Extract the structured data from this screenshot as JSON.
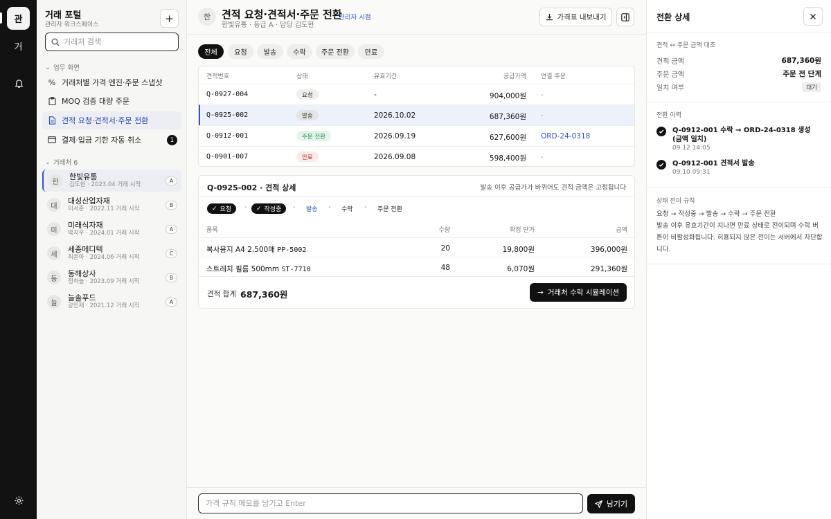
{
  "rail": {
    "active_label": "관",
    "second_label": "거"
  },
  "sidebar": {
    "title": "거래 포털",
    "subtitle": "관리자 워크스페이스",
    "search_placeholder": "거래처 검색",
    "section_screens": "업무 화면",
    "nav": [
      {
        "label": "거래처별 가격 엔진·주문 스냅샷",
        "icon": "percent-icon"
      },
      {
        "label": "MOQ 검증 대량 주문",
        "icon": "clipboard-icon"
      },
      {
        "label": "견적 요청·견적서·주문 전환",
        "icon": "document-icon",
        "active": true
      },
      {
        "label": "결제·입금 기한 자동 취소",
        "icon": "card-icon",
        "badge": "1"
      }
    ],
    "section_clients": "거래처 6",
    "clients": [
      {
        "initial": "한",
        "name": "한빛유통",
        "meta": "김도현 · 2023.04 거래 시작",
        "grade": "A",
        "active": true
      },
      {
        "initial": "대",
        "name": "대성산업자재",
        "meta": "이서준 · 2022.11 거래 시작",
        "grade": "B"
      },
      {
        "initial": "미",
        "name": "미래식자재",
        "meta": "박지우 · 2024.01 거래 시작",
        "grade": "A"
      },
      {
        "initial": "세",
        "name": "세종메디텍",
        "meta": "최윤아 · 2024.06 거래 시작",
        "grade": "C"
      },
      {
        "initial": "동",
        "name": "동해상사",
        "meta": "정하늘 · 2023.09 거래 시작",
        "grade": "B"
      },
      {
        "initial": "늘",
        "name": "늘솔푸드",
        "meta": "강민재 · 2021.12 거래 시작",
        "grade": "A"
      }
    ]
  },
  "header": {
    "avatar": "한",
    "title": "견적 요청·견적서·주문 전환",
    "subtitle": "한빛유통 · 등급 A · 담당 김도현",
    "view_link": "관리자 시점",
    "export_label": "가격표 내보내기"
  },
  "filters": [
    "전체",
    "요청",
    "발송",
    "수락",
    "주문 전환",
    "만료"
  ],
  "quotes": {
    "columns": [
      "견적번호",
      "상태",
      "유효기간",
      "공급가액",
      "연결 주문"
    ],
    "rows": [
      {
        "id": "Q-0927-004",
        "status": "요청",
        "status_kind": "request",
        "valid": "-",
        "amount": "904,000원",
        "order": "-"
      },
      {
        "id": "Q-0925-002",
        "status": "발송",
        "status_kind": "sent",
        "valid": "2026.10.02",
        "amount": "687,360원",
        "order": "-",
        "selected": true
      },
      {
        "id": "Q-0912-001",
        "status": "주문 전환",
        "status_kind": "converted",
        "valid": "2026.09.19",
        "amount": "627,600원",
        "order": "ORD-24-0318"
      },
      {
        "id": "Q-0901-007",
        "status": "만료",
        "status_kind": "expired",
        "valid": "2026.09.08",
        "amount": "598,400원",
        "order": "-"
      }
    ]
  },
  "detail": {
    "title": "Q-0925-002 · 견적 상세",
    "note": "발송 이후 공급가가 바뀌어도 견적 금액은 고정됩니다",
    "steps": [
      {
        "label": "요청",
        "state": "done"
      },
      {
        "label": "작성중",
        "state": "done"
      },
      {
        "label": "발송",
        "state": "current"
      },
      {
        "label": "수락",
        "state": "todo"
      },
      {
        "label": "주문 전환",
        "state": "todo"
      }
    ],
    "columns": [
      "품목",
      "수량",
      "확정 단가",
      "금액"
    ],
    "items": [
      {
        "name": "복사용지 A4 2,500매",
        "code": "PP-5002",
        "qty": "20",
        "price": "19,800원",
        "amount": "396,000원"
      },
      {
        "name": "스트레치 필름 500mm",
        "code": "ST-7710",
        "qty": "48",
        "price": "6,070원",
        "amount": "291,360원"
      }
    ],
    "total_label": "견적 합계",
    "total_value": "687,360원",
    "sim_label": "거래처 수락 시뮬레이션"
  },
  "footer": {
    "memo_placeholder": "가격 규칙 메모를 남기고 Enter",
    "send_label": "남기기"
  },
  "panel": {
    "title": "전환 상세",
    "compare_title": "견적 ↔ 주문 금액 대조",
    "compare": [
      {
        "key": "견적 금액",
        "value": "687,360원"
      },
      {
        "key": "주문 금액",
        "value": "주문 전 단계"
      },
      {
        "key": "일치 여부",
        "value": "대기",
        "tag": true
      }
    ],
    "history_title": "전환 이력",
    "history": [
      {
        "text": "Q-0912-001 수락 → ORD-24-0318 생성 (금액 일치)",
        "time": "09.12 14:05"
      },
      {
        "text": "Q-0912-001 견적서 발송",
        "time": "09.10 09:31"
      }
    ],
    "rules_title": "상태 전이 규칙",
    "rules_flow": "요청 → 작성중 → 발송 → 수락 → 주문 전환",
    "rules_body": "발송 이후 유효기간이 지나면 만료 상태로 전이되며 수락 버튼이 비활성화됩니다. 허용되지 않은 전이는 서버에서 차단합니다."
  },
  "colors": {
    "accent": "#2f54c8",
    "dark": "#111111",
    "selected_bg": "#edf1fa",
    "converted": "#2e8b57",
    "expired": "#c0392b"
  }
}
